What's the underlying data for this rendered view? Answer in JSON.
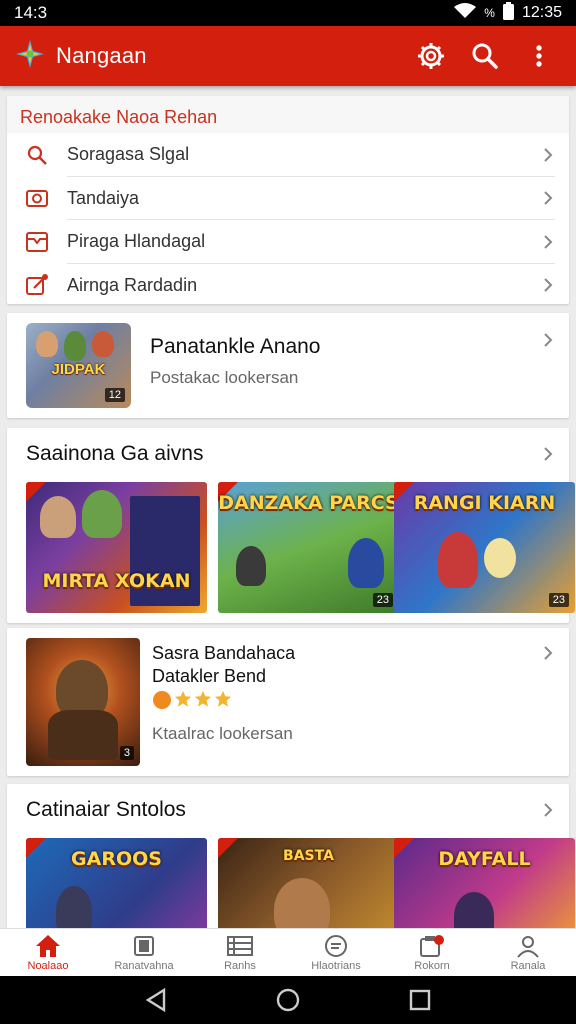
{
  "status_bar": {
    "time": "14:3",
    "battery_percent": "%",
    "clock_right": "12:35"
  },
  "app_bar": {
    "title": "Nangaan",
    "colors": {
      "primary": "#d3200e"
    }
  },
  "menu_card": {
    "header": "Renoakake Naoa Rehan",
    "items": [
      {
        "label": "Soragasa Slgal",
        "icon": "search-icon"
      },
      {
        "label": "Tandaiya",
        "icon": "camera-icon"
      },
      {
        "label": "Piraga Hlandagal",
        "icon": "inbox-icon"
      },
      {
        "label": "Airnga Rardadin",
        "icon": "edit-icon"
      }
    ]
  },
  "feature_card": {
    "title": "Panatankle Anano",
    "subtitle": "Postakac lookersan",
    "thumb_text": "JIDPAK",
    "thumb_count": "12"
  },
  "games_section": {
    "title": "Saainona Ga aivns",
    "tiles": [
      {
        "label": "MIRTA XOKAN",
        "count": ""
      },
      {
        "label": "DANZAKA PARCS",
        "count": "23"
      },
      {
        "label": "RANGI KIARN",
        "count": "23"
      }
    ]
  },
  "featured2": {
    "title_line1": "Sasra Bandahaca",
    "title_line2": "Datakler Bend",
    "rating": 3.5,
    "subtitle": "Ktaalrac lookersan",
    "count": "3"
  },
  "bottom_section": {
    "title": "Catinaiar Sntolos",
    "tiles": [
      {
        "label": "GAROOS"
      },
      {
        "label": "BASTA"
      },
      {
        "label": "DAYFALL"
      }
    ]
  },
  "bottom_nav": [
    {
      "label": "Noalaao",
      "icon": "home-icon",
      "active": true
    },
    {
      "label": "Ranatvahna",
      "icon": "book-icon",
      "active": false
    },
    {
      "label": "Ranhs",
      "icon": "film-icon",
      "active": false
    },
    {
      "label": "Hlaotrians",
      "icon": "chat-icon",
      "active": false
    },
    {
      "label": "Rokorn",
      "icon": "notification-icon",
      "active": false
    },
    {
      "label": "Ranala",
      "icon": "profile-icon",
      "active": false
    }
  ]
}
